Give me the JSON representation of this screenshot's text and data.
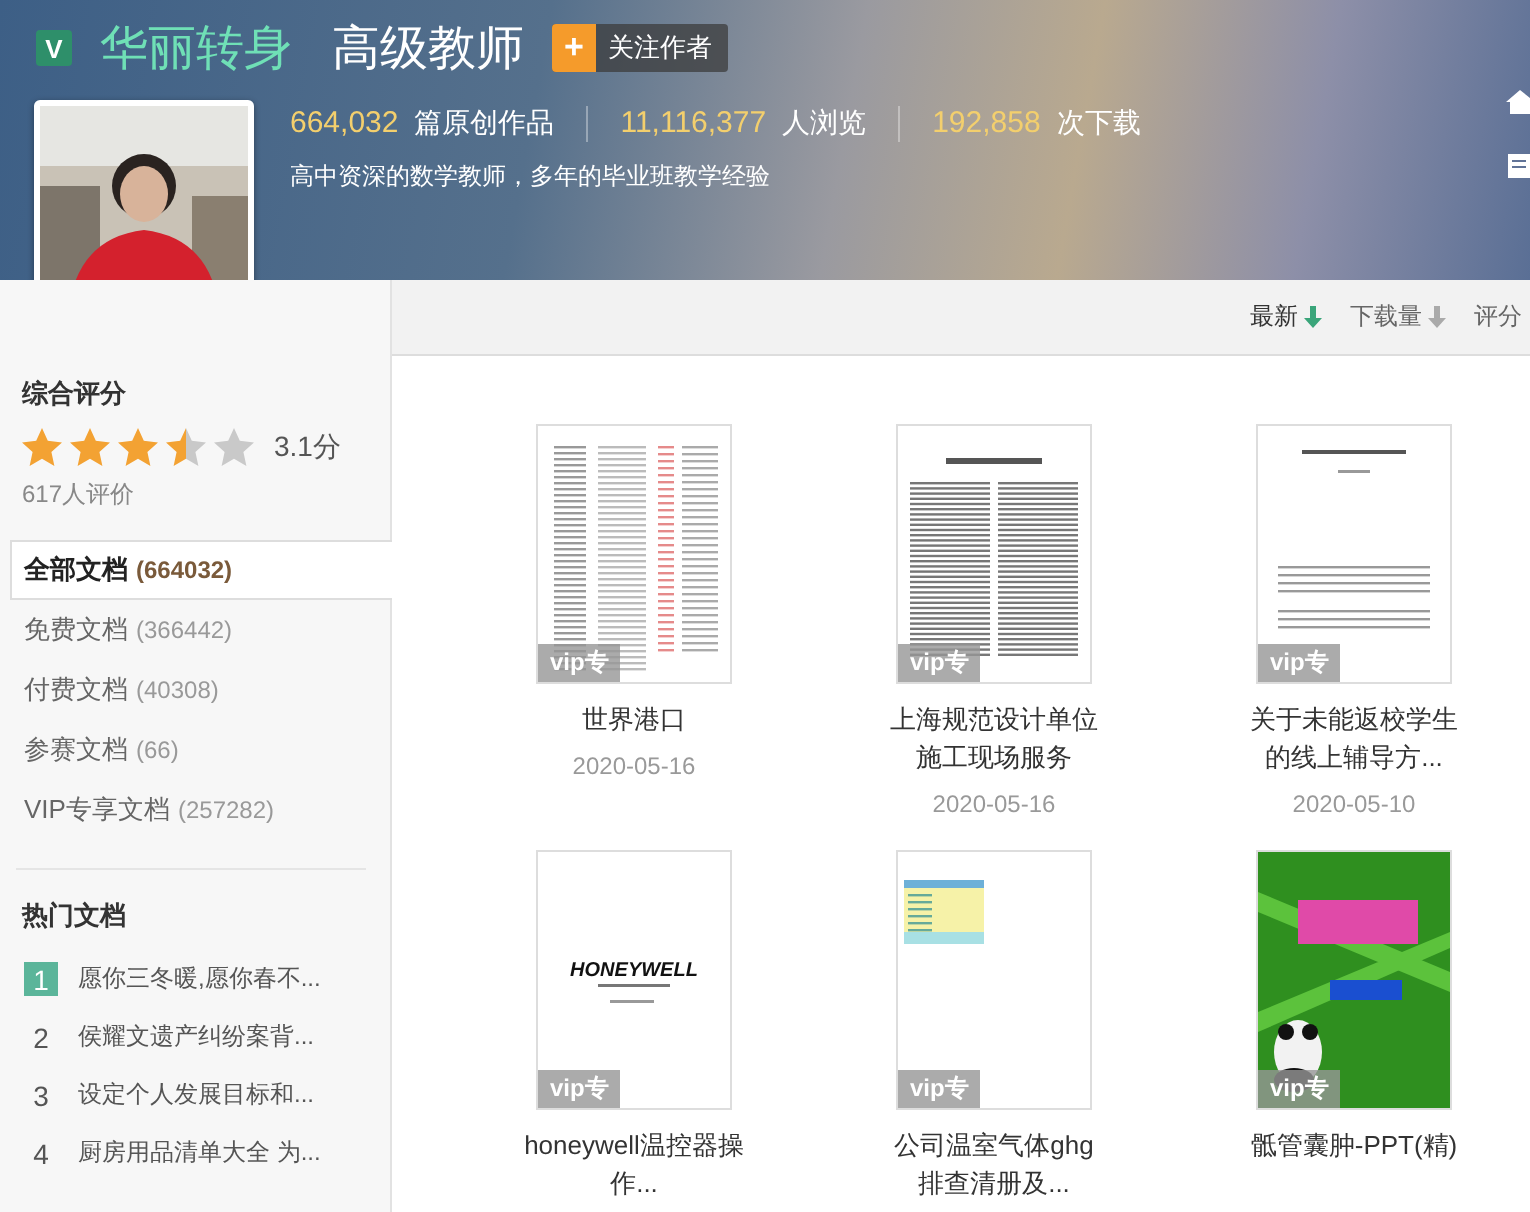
{
  "header": {
    "badge": "V",
    "name": "华丽转身",
    "title": "高级教师",
    "follow": {
      "icon": "+",
      "label": "关注作者"
    },
    "stats": [
      {
        "value": "664,032",
        "label": "篇原创作品"
      },
      {
        "value": "11,116,377",
        "label": "人浏览"
      },
      {
        "value": "192,858",
        "label": "次下载"
      }
    ],
    "description": "高中资深的数学教师，多年的毕业班教学经验"
  },
  "rating": {
    "title": "综合评分",
    "stars": 3.5,
    "score": "3.1分",
    "count": "617人评价"
  },
  "categories": [
    {
      "label": "全部文档",
      "count": "(664032)",
      "selected": true
    },
    {
      "label": "免费文档",
      "count": "(366442)",
      "selected": false
    },
    {
      "label": "付费文档",
      "count": "(40308)",
      "selected": false
    },
    {
      "label": "参赛文档",
      "count": "(66)",
      "selected": false
    },
    {
      "label": "VIP专享文档",
      "count": "(257282)",
      "selected": false
    }
  ],
  "hot": {
    "title": "热门文档",
    "items": [
      {
        "rank": "1",
        "title": "愿你三冬暖,愿你春不...",
        "highlighted": true
      },
      {
        "rank": "2",
        "title": "侯耀文遗产纠纷案背...",
        "highlighted": false
      },
      {
        "rank": "3",
        "title": "设定个人发展目标和...",
        "highlighted": false
      },
      {
        "rank": "4",
        "title": "厨房用品清单大全 为...",
        "highlighted": false
      }
    ]
  },
  "sort": [
    {
      "label": "最新",
      "selected": true
    },
    {
      "label": "下载量",
      "selected": false
    },
    {
      "label": "评分",
      "selected": false
    }
  ],
  "documents": [
    {
      "kind": "table",
      "tag": "vip专",
      "title": "世界港口",
      "date": "2020-05-16"
    },
    {
      "kind": "article",
      "tag": "vip专",
      "title": "上海规范设计单位施工现场服务",
      "date": "2020-05-16"
    },
    {
      "kind": "letter",
      "tag": "vip专",
      "title": "关于未能返校学生的线上辅导方...",
      "date": "2020-05-10"
    },
    {
      "kind": "cover",
      "cover_text": "HONEYWELL",
      "tag": "vip专",
      "title": "honeywell温控器操作..."
    },
    {
      "kind": "spreadsheet",
      "tag": "vip专",
      "title": "公司温室气体ghg排查清册及..."
    },
    {
      "kind": "slide",
      "tag": "vip专",
      "title": "骶管囊肿-PPT(精)"
    }
  ]
}
